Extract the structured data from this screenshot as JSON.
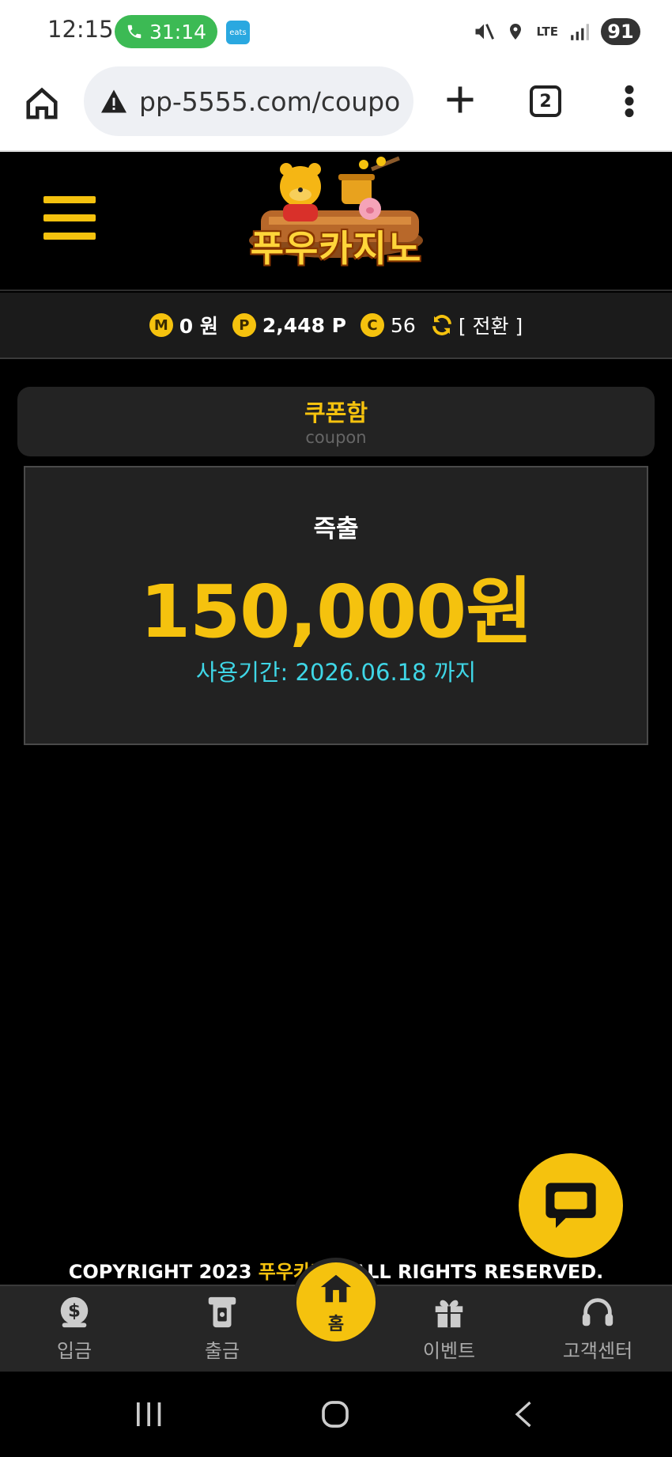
{
  "status_bar": {
    "time": "12:15",
    "call_timer": "31:14",
    "eats_label": "eats",
    "network": "LTE",
    "battery": "91"
  },
  "browser": {
    "url": "pp-5555.com/coupo",
    "tab_count": "2"
  },
  "site": {
    "logo_text": "푸우카지노"
  },
  "balance": {
    "money_badge": "M",
    "money": "0 원",
    "point_badge": "P",
    "points": "2,448 P",
    "coupon_badge": "C",
    "coupons": "56",
    "switch_label": "[ 전환 ]"
  },
  "coupon_box": {
    "title": "쿠폰함",
    "subtitle": "coupon"
  },
  "coupon_card": {
    "label": "즉출",
    "amount": "150,000원",
    "period": "사용기간: 2026.06.18 까지"
  },
  "footer": {
    "copyright_prefix": "COPYRIGHT 2023",
    "copyright_brand": "푸우카지노",
    "copyright_suffix": "ALL RIGHTS RESERVED."
  },
  "bottom_nav": {
    "deposit": "입금",
    "withdraw": "출금",
    "home": "홈",
    "event": "이벤트",
    "support": "고객센터"
  },
  "colors": {
    "accent": "#f5c20e",
    "period_text": "#3fd6e6",
    "background": "#000000",
    "card_bg": "#222222"
  }
}
